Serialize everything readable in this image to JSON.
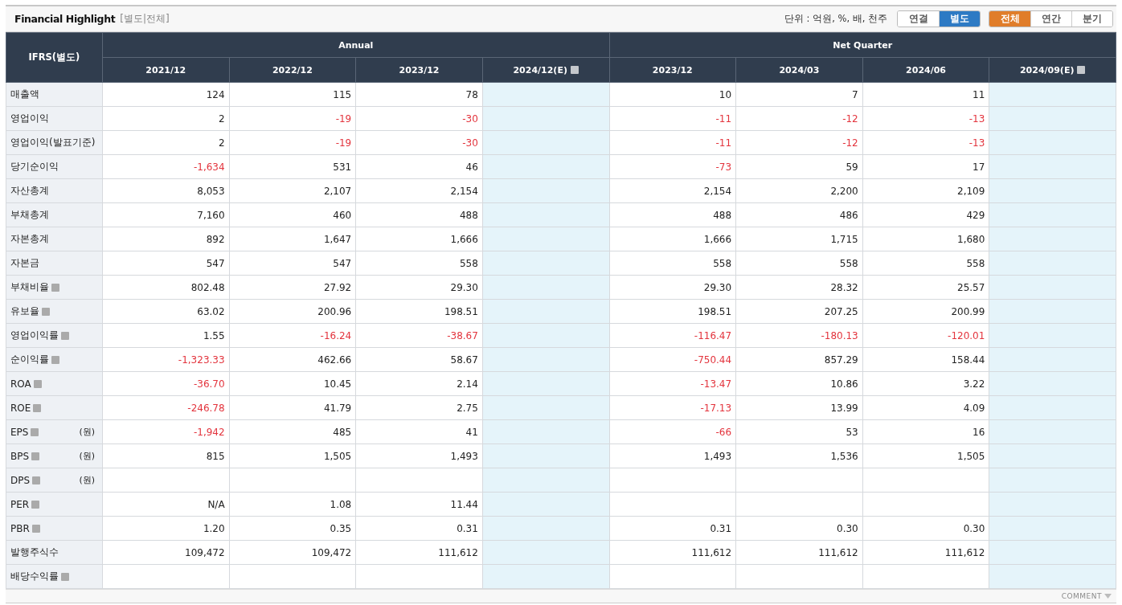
{
  "title": "Financial Highlight",
  "subtitle": "[별도|전체]",
  "unit_label": "단위 : 억원, %, 배, 천주",
  "report_toggle": [
    {
      "label": "연결",
      "selected": false
    },
    {
      "label": "별도",
      "selected": true
    }
  ],
  "period_toggle": [
    {
      "label": "전체",
      "selected": true
    },
    {
      "label": "연간",
      "selected": false
    },
    {
      "label": "분기",
      "selected": false
    }
  ],
  "table": {
    "corner": "IFRS(별도)",
    "groups": [
      {
        "label": "Annual",
        "columns": [
          {
            "label": "2021/12",
            "estimate": false
          },
          {
            "label": "2022/12",
            "estimate": false
          },
          {
            "label": "2023/12",
            "estimate": false
          },
          {
            "label": "2024/12(E)",
            "estimate": true
          }
        ]
      },
      {
        "label": "Net Quarter",
        "columns": [
          {
            "label": "2023/12",
            "estimate": false
          },
          {
            "label": "2024/03",
            "estimate": false
          },
          {
            "label": "2024/06",
            "estimate": false
          },
          {
            "label": "2024/09(E)",
            "estimate": true
          }
        ]
      }
    ],
    "rows": [
      {
        "label": "매출액",
        "help": false,
        "cells": [
          "124",
          "115",
          "78",
          null,
          "10",
          "7",
          "11",
          null
        ]
      },
      {
        "label": "영업이익",
        "help": false,
        "cells": [
          "2",
          {
            "text": "-19",
            "negative": true
          },
          {
            "text": "-30",
            "negative": true
          },
          null,
          {
            "text": "-11",
            "negative": true
          },
          {
            "text": "-12",
            "negative": true
          },
          {
            "text": "-13",
            "negative": true
          },
          null
        ]
      },
      {
        "label": "영업이익(발표기준)",
        "help": false,
        "cells": [
          "2",
          {
            "text": "-19",
            "negative": true
          },
          {
            "text": "-30",
            "negative": true
          },
          null,
          {
            "text": "-11",
            "negative": true
          },
          {
            "text": "-12",
            "negative": true
          },
          {
            "text": "-13",
            "negative": true
          },
          null
        ]
      },
      {
        "label": "당기순이익",
        "help": false,
        "cells": [
          {
            "text": "-1,634",
            "negative": true
          },
          "531",
          "46",
          null,
          {
            "text": "-73",
            "negative": true
          },
          "59",
          "17",
          null
        ]
      },
      {
        "label": "자산총계",
        "help": false,
        "cells": [
          "8,053",
          "2,107",
          "2,154",
          null,
          "2,154",
          "2,200",
          "2,109",
          null
        ]
      },
      {
        "label": "부채총계",
        "help": false,
        "cells": [
          "7,160",
          "460",
          "488",
          null,
          "488",
          "486",
          "429",
          null
        ]
      },
      {
        "label": "자본총계",
        "help": false,
        "cells": [
          "892",
          "1,647",
          "1,666",
          null,
          "1,666",
          "1,715",
          "1,680",
          null
        ]
      },
      {
        "label": "자본금",
        "help": false,
        "cells": [
          "547",
          "547",
          "558",
          null,
          "558",
          "558",
          "558",
          null
        ]
      },
      {
        "label": "부채비율",
        "help": true,
        "cells": [
          "802.48",
          "27.92",
          "29.30",
          null,
          "29.30",
          "28.32",
          "25.57",
          null
        ]
      },
      {
        "label": "유보율",
        "help": true,
        "cells": [
          "63.02",
          "200.96",
          "198.51",
          null,
          "198.51",
          "207.25",
          "200.99",
          null
        ]
      },
      {
        "label": "영업이익률",
        "help": true,
        "cells": [
          "1.55",
          {
            "text": "-16.24",
            "negative": true
          },
          {
            "text": "-38.67",
            "negative": true
          },
          null,
          {
            "text": "-116.47",
            "negative": true
          },
          {
            "text": "-180.13",
            "negative": true
          },
          {
            "text": "-120.01",
            "negative": true
          },
          null
        ]
      },
      {
        "label": "순이익률",
        "help": true,
        "cells": [
          {
            "text": "-1,323.33",
            "negative": true
          },
          "462.66",
          "58.67",
          null,
          {
            "text": "-750.44",
            "negative": true
          },
          "857.29",
          "158.44",
          null
        ]
      },
      {
        "label": "ROA",
        "help": true,
        "cells": [
          {
            "text": "-36.70",
            "negative": true
          },
          "10.45",
          "2.14",
          null,
          {
            "text": "-13.47",
            "negative": true
          },
          "10.86",
          "3.22",
          null
        ]
      },
      {
        "label": "ROE",
        "help": true,
        "cells": [
          {
            "text": "-246.78",
            "negative": true
          },
          "41.79",
          "2.75",
          null,
          {
            "text": "-17.13",
            "negative": true
          },
          "13.99",
          "4.09",
          null
        ]
      },
      {
        "label": "EPS",
        "help": true,
        "unit": "(원)",
        "cells": [
          {
            "text": "-1,942",
            "negative": true
          },
          "485",
          "41",
          null,
          {
            "text": "-66",
            "negative": true
          },
          "53",
          "16",
          null
        ]
      },
      {
        "label": "BPS",
        "help": true,
        "unit": "(원)",
        "cells": [
          "815",
          "1,505",
          "1,493",
          null,
          "1,493",
          "1,536",
          "1,505",
          null
        ]
      },
      {
        "label": "DPS",
        "help": true,
        "unit": "(원)",
        "cells": [
          null,
          null,
          null,
          null,
          null,
          null,
          null,
          null
        ]
      },
      {
        "label": "PER",
        "help": true,
        "cells": [
          "N/A",
          "1.08",
          "11.44",
          null,
          null,
          null,
          null,
          null
        ]
      },
      {
        "label": "PBR",
        "help": true,
        "cells": [
          "1.20",
          "0.35",
          "0.31",
          null,
          "0.31",
          "0.30",
          "0.30",
          null
        ]
      },
      {
        "label": "발행주식수",
        "help": false,
        "cells": [
          "109,472",
          "109,472",
          "111,612",
          null,
          "111,612",
          "111,612",
          "111,612",
          null
        ]
      },
      {
        "label": "배당수익률",
        "help": true,
        "cells": [
          null,
          null,
          null,
          null,
          null,
          null,
          null,
          null
        ]
      }
    ]
  },
  "footer": {
    "comment_label": "COMMENT"
  }
}
